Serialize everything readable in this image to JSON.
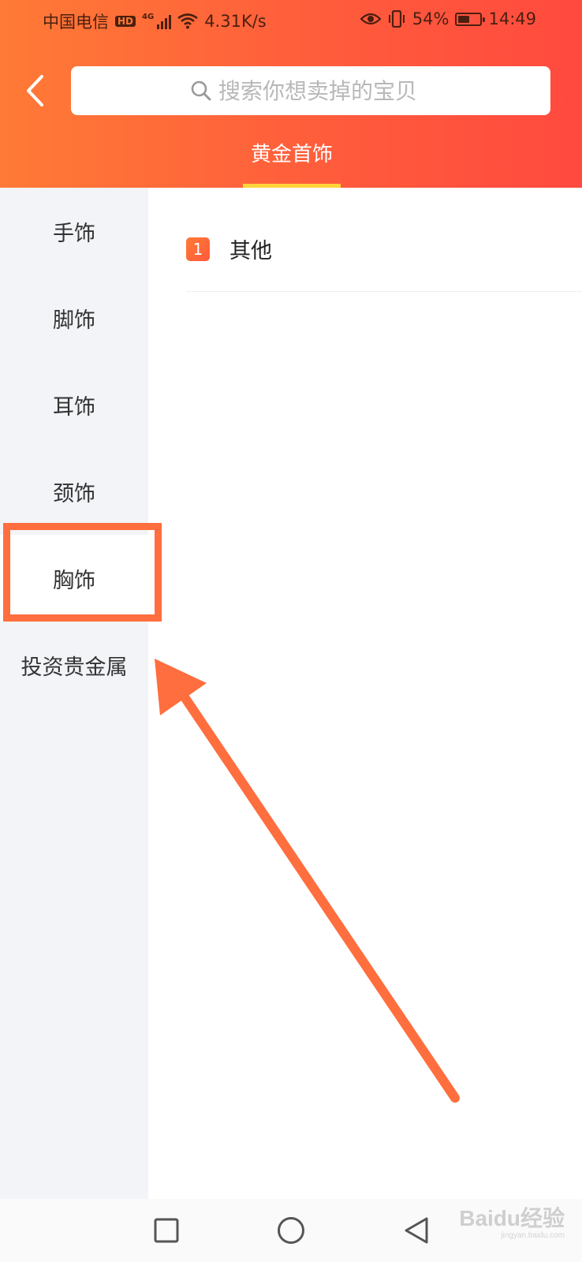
{
  "status_bar": {
    "carrier": "中国电信",
    "hd": "HD",
    "network": "4G",
    "speed": "4.31K/s",
    "battery": "54%",
    "battery_level": 0.54,
    "time": "14:49"
  },
  "search": {
    "placeholder": "搜索你想卖掉的宝贝"
  },
  "tabs": [
    {
      "label": "黄金首饰",
      "active": true
    }
  ],
  "sidebar": {
    "items": [
      {
        "label": "手饰",
        "selected": false
      },
      {
        "label": "脚饰",
        "selected": false
      },
      {
        "label": "耳饰",
        "selected": false
      },
      {
        "label": "颈饰",
        "selected": false
      },
      {
        "label": "胸饰",
        "selected": true
      },
      {
        "label": "投资贵金属",
        "selected": false
      }
    ]
  },
  "content": {
    "items": [
      {
        "rank": "1",
        "label": "其他"
      }
    ]
  },
  "watermark": {
    "brand": "Baidu经验",
    "sub": "jingyan.baidu.com"
  },
  "colors": {
    "header_start": "#ff7a36",
    "header_end": "#ff4a3f",
    "tab_underline": "#ffd43a",
    "annotation": "#ff6e3e",
    "sidebar_bg": "#f3f4f8"
  }
}
